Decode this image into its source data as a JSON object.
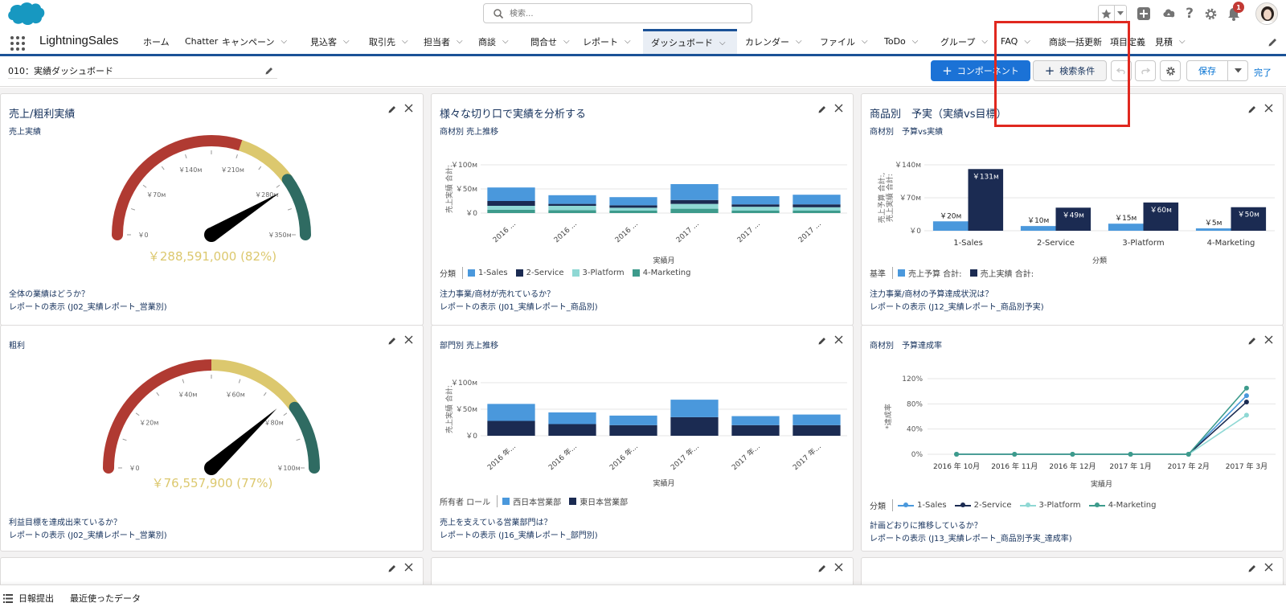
{
  "header": {
    "search_placeholder": "検索...",
    "notification_count": "1"
  },
  "nav": {
    "app_name": "LightningSales",
    "items": [
      {
        "label": "ホーム",
        "dropdown": false
      },
      {
        "label": "Chatter",
        "dropdown": false
      },
      {
        "label": "キャンペーン",
        "dropdown": true
      },
      {
        "label": "見込客",
        "dropdown": true
      },
      {
        "label": "取引先",
        "dropdown": true
      },
      {
        "label": "担当者",
        "dropdown": true
      },
      {
        "label": "商談",
        "dropdown": true
      },
      {
        "label": "問合せ",
        "dropdown": true
      },
      {
        "label": "レポート",
        "dropdown": true
      },
      {
        "label": "ダッシュボード",
        "dropdown": true,
        "active": true
      },
      {
        "label": "カレンダー",
        "dropdown": true
      },
      {
        "label": "ファイル",
        "dropdown": true
      },
      {
        "label": "ToDo",
        "dropdown": true
      },
      {
        "label": "グループ",
        "dropdown": true
      },
      {
        "label": "FAQ",
        "dropdown": true
      },
      {
        "label": "商談一括更新",
        "dropdown": false
      },
      {
        "label": "項目定義",
        "dropdown": false
      },
      {
        "label": "見積",
        "dropdown": true
      }
    ]
  },
  "toolbar": {
    "dashboard_name": "010：実績ダッシュボード",
    "add_component": "コンポーネント",
    "add_filter": "検索条件",
    "save": "保存",
    "done": "完了"
  },
  "cards": {
    "c1": {
      "title": "売上/粗利実績",
      "subtitle": "売上実績",
      "value_label": "￥288,591,000 (82%)",
      "footer_question": "全体の業績はどうか？",
      "footer_report": "レポートの表示 (J02_実績レポート_営業別)"
    },
    "c2": {
      "title": "様々な切り口で実績を分析する",
      "subtitle": "商材別 売上推移",
      "legend_title": "分類",
      "footer_question": "注力事業/商材が売れているか？",
      "footer_report": "レポートの表示 (J01_実績レポート_商品別)"
    },
    "c3": {
      "title": "商品別　予実（実績vs目標）",
      "subtitle": "商材別　予算vs実績",
      "legend_title": "基準",
      "footer_question": "注力事業/商材の予算達成状況は？",
      "footer_report": "レポートの表示 (J12_実績レポート_商品別予実)"
    },
    "c4": {
      "subtitle": "粗利",
      "value_label": "￥76,557,900 (77%)",
      "footer_question": "利益目標を達成出来ているか？",
      "footer_report": "レポートの表示 (J02_実績レポート_営業別)"
    },
    "c5": {
      "subtitle": "部門別 売上推移",
      "legend_title": "所有者 ロール",
      "footer_question": "売上を支えている営業部門は？",
      "footer_report": "レポートの表示 (J16_実績レポート_部門別)"
    },
    "c6": {
      "subtitle": "商材別　予算達成率",
      "legend_title": "分類",
      "footer_question": "計画どおりに推移しているか？",
      "footer_report": "レポートの表示 (J13_実績レポート_商品別予実_達成率)"
    }
  },
  "utility": {
    "daily_report": "日報提出",
    "recent": "最近使ったデータ"
  },
  "colors": {
    "sales": "#4a98dc",
    "service": "#1b2b52",
    "platform": "#8fd8d4",
    "marketing": "#3d9b8c",
    "gauge_red": "#b03a32",
    "gauge_yellow": "#dcc86e",
    "gauge_green": "#2f6b62"
  },
  "chart_data": [
    {
      "id": "c1",
      "type": "gauge",
      "value": 288591000,
      "percent": 82,
      "min": 0,
      "max": 350000000,
      "ticks": [
        "￥0",
        "￥70м",
        "￥140м",
        "￥210м",
        "￥280м",
        "￥350м"
      ],
      "bands": [
        {
          "to": 210000000,
          "color": "#b03a32"
        },
        {
          "to": 280000000,
          "color": "#dcc86e"
        },
        {
          "to": 350000000,
          "color": "#2f6b62"
        }
      ]
    },
    {
      "id": "c2",
      "type": "bar",
      "stacked": true,
      "xlabel": "実績月",
      "ylabel": "売上実績 合計:",
      "ylim": [
        0,
        100
      ],
      "yticks": [
        "￥0",
        "￥50м",
        "￥100м"
      ],
      "categories": [
        "2016 ...",
        "2016 ...",
        "2016 ...",
        "2017 ...",
        "2017 ...",
        "2017 ..."
      ],
      "series": [
        {
          "name": "4-Marketing",
          "values": [
            7,
            6,
            5,
            9,
            5,
            5
          ],
          "color": "#3d9b8c"
        },
        {
          "name": "3-Platform",
          "values": [
            8,
            9,
            6,
            10,
            8,
            7
          ],
          "color": "#8fd8d4"
        },
        {
          "name": "2-Service",
          "values": [
            10,
            4,
            5,
            8,
            5,
            6
          ],
          "color": "#1b2b52"
        },
        {
          "name": "1-Sales",
          "values": [
            28,
            18,
            17,
            33,
            17,
            20
          ],
          "color": "#4a98dc"
        }
      ]
    },
    {
      "id": "c3",
      "type": "bar",
      "grouped": true,
      "xlabel": "分類",
      "ylabel": "売上予算 合計:, 売上実績 合計:",
      "ylim": [
        0,
        140
      ],
      "yticks": [
        "￥0",
        "￥70м",
        "￥140м"
      ],
      "categories": [
        "1-Sales",
        "2-Service",
        "3-Platform",
        "4-Marketing"
      ],
      "series": [
        {
          "name": "売上予算 合計:",
          "values": [
            20,
            10,
            15,
            5
          ],
          "labels": [
            "￥20м",
            "￥10м",
            "￥15м",
            "￥5м"
          ],
          "color": "#4a98dc"
        },
        {
          "name": "売上実績 合計:",
          "values": [
            131,
            49,
            60,
            50
          ],
          "labels": [
            "￥131м",
            "￥49м",
            "￥60м",
            "￥50м"
          ],
          "color": "#1b2b52"
        }
      ]
    },
    {
      "id": "c4",
      "type": "gauge",
      "value": 76557900,
      "percent": 77,
      "min": 0,
      "max": 100000000,
      "ticks": [
        "￥0",
        "￥20м",
        "￥40м",
        "￥60м",
        "￥80м",
        "￥100м"
      ],
      "bands": [
        {
          "to": 50000000,
          "color": "#b03a32"
        },
        {
          "to": 80000000,
          "color": "#dcc86e"
        },
        {
          "to": 100000000,
          "color": "#2f6b62"
        }
      ]
    },
    {
      "id": "c5",
      "type": "bar",
      "stacked": true,
      "xlabel": "実績月",
      "ylabel": "売上実績 合計:",
      "ylim": [
        0,
        100
      ],
      "yticks": [
        "￥0",
        "￥50м",
        "￥100м"
      ],
      "categories": [
        "2016 年...",
        "2016 年...",
        "2016 年...",
        "2017 年...",
        "2017 年...",
        "2017 年..."
      ],
      "series": [
        {
          "name": "東日本営業部",
          "values": [
            28,
            22,
            20,
            35,
            20,
            20
          ],
          "color": "#1b2b52"
        },
        {
          "name": "西日本営業部",
          "values": [
            32,
            22,
            18,
            33,
            17,
            20
          ],
          "color": "#4a98dc"
        }
      ]
    },
    {
      "id": "c6",
      "type": "line",
      "xlabel": "実績月",
      "ylabel": "*達成率",
      "ylim": [
        0,
        120
      ],
      "yticks": [
        "0%",
        "40%",
        "80%",
        "120%"
      ],
      "x": [
        "2016 年 10月",
        "2016 年 11月",
        "2016 年 12月",
        "2017 年 1月",
        "2017 年 2月",
        "2017 年 3月"
      ],
      "series": [
        {
          "name": "1-Sales",
          "values": [
            0,
            0,
            0,
            0,
            0,
            93
          ],
          "color": "#4a98dc"
        },
        {
          "name": "2-Service",
          "values": [
            0,
            0,
            0,
            0,
            0,
            83
          ],
          "color": "#1b2b52"
        },
        {
          "name": "3-Platform",
          "values": [
            0,
            0,
            0,
            0,
            0,
            62
          ],
          "color": "#8fd8d4"
        },
        {
          "name": "4-Marketing",
          "values": [
            0,
            0,
            0,
            0,
            0,
            105
          ],
          "color": "#3d9b8c"
        }
      ]
    }
  ]
}
